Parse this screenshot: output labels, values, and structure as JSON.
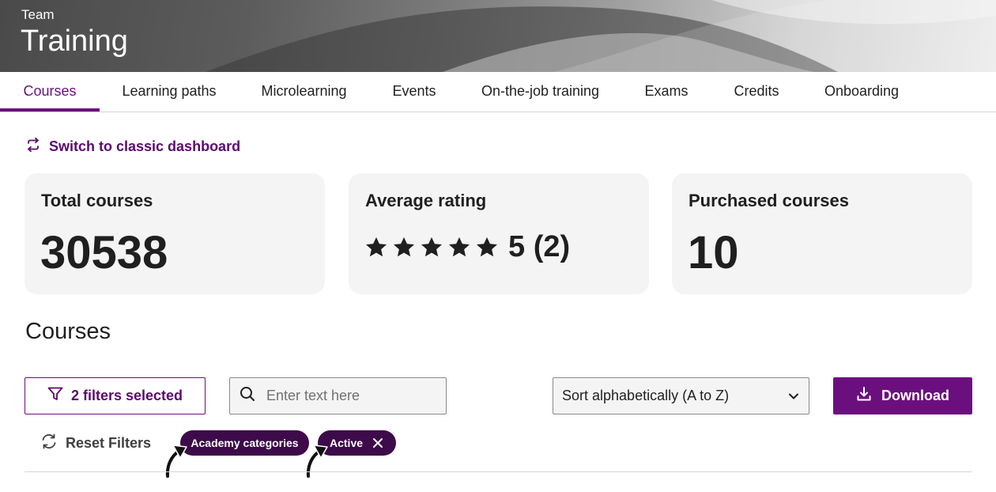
{
  "header": {
    "team": "Team",
    "title": "Training"
  },
  "tabs": [
    {
      "label": "Courses",
      "active": true
    },
    {
      "label": "Learning paths",
      "active": false
    },
    {
      "label": "Microlearning",
      "active": false
    },
    {
      "label": "Events",
      "active": false
    },
    {
      "label": "On-the-job training",
      "active": false
    },
    {
      "label": "Exams",
      "active": false
    },
    {
      "label": "Credits",
      "active": false
    },
    {
      "label": "Onboarding",
      "active": false
    }
  ],
  "switch_link": {
    "label": "Switch to classic dashboard",
    "icon": "swap-arrows-icon"
  },
  "stats": {
    "total_courses": {
      "label": "Total courses",
      "value": "30538"
    },
    "average_rating": {
      "label": "Average rating",
      "value": "5 (2)",
      "stars": 5,
      "icon": "star-icon"
    },
    "purchased_courses": {
      "label": "Purchased courses",
      "value": "10"
    }
  },
  "courses_section": {
    "heading": "Courses"
  },
  "toolbar": {
    "filter_label": "2 filters selected",
    "filter_icon": "funnel-icon",
    "search_placeholder": "Enter text here",
    "search_value": "",
    "search_icon": "search-icon",
    "sort_selected": "Sort alphabetically (A to Z)",
    "sort_icon": "chevron-down-icon",
    "download_label": "Download",
    "download_icon": "download-icon"
  },
  "filters": {
    "reset_label": "Reset Filters",
    "reset_icon": "refresh-icon",
    "chips": [
      {
        "label": "Academy categories"
      },
      {
        "label": "Active",
        "removable": true
      }
    ]
  },
  "colors": {
    "accent": "#6b0f7f",
    "accent_dark": "#5c0a6e",
    "chip_bg": "#3d0a4a",
    "card_bg": "#f4f4f4",
    "input_bg": "#f4f4f4"
  }
}
